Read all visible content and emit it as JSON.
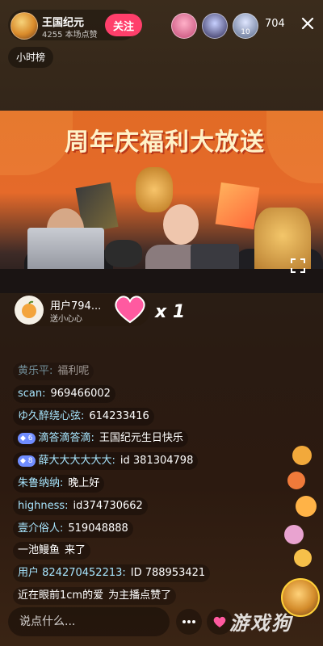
{
  "host": {
    "name": "王国纪元",
    "subtitle": "4255 本场点赞",
    "follow_label": "关注"
  },
  "viewers": {
    "badges": [
      "",
      "",
      "10"
    ],
    "count": "704"
  },
  "rank": {
    "label": "小时榜"
  },
  "banner": {
    "title": "周年庆福利大放送"
  },
  "gift": {
    "user": "用户794...",
    "action": "送小心心",
    "multiplier": "x 1"
  },
  "chat": [
    {
      "user": "黄乐平:",
      "text": "福利呢",
      "badge": ""
    },
    {
      "user": "scan:",
      "text": "969466002",
      "badge": ""
    },
    {
      "user": "ゆ久醉绕心弦:",
      "text": "614233416",
      "badge": ""
    },
    {
      "user": "滴答滴答滴:",
      "text": "王国纪元生日快乐",
      "badge": "6"
    },
    {
      "user": "薛大大大大大大:",
      "text": "id 381304798",
      "badge": "8"
    },
    {
      "user": "朱鲁纳纳:",
      "text": "晚上好",
      "badge": ""
    },
    {
      "user": "highness:",
      "text": "id374730662",
      "badge": ""
    },
    {
      "user": "壹介俗人:",
      "text": "519048888",
      "badge": ""
    },
    {
      "user": "一池鳗鱼",
      "text": "来了",
      "badge": ""
    },
    {
      "user": "用户 824270452213:",
      "text": "ID 788953421",
      "badge": ""
    },
    {
      "user": "近在眼前1cm的爱",
      "text": "为主播点赞了",
      "badge": ""
    }
  ],
  "input": {
    "placeholder": "说点什么..."
  },
  "watermark": "游戏狗",
  "colors": {
    "follow": "#ff3f6b",
    "chat_user": "#a8e6ff",
    "banner_orange": "#e16b25",
    "heart": "#ff5aa0"
  },
  "icons": [
    "close-icon",
    "fullscreen-icon",
    "heart-icon",
    "share-icon",
    "gift-icon"
  ]
}
